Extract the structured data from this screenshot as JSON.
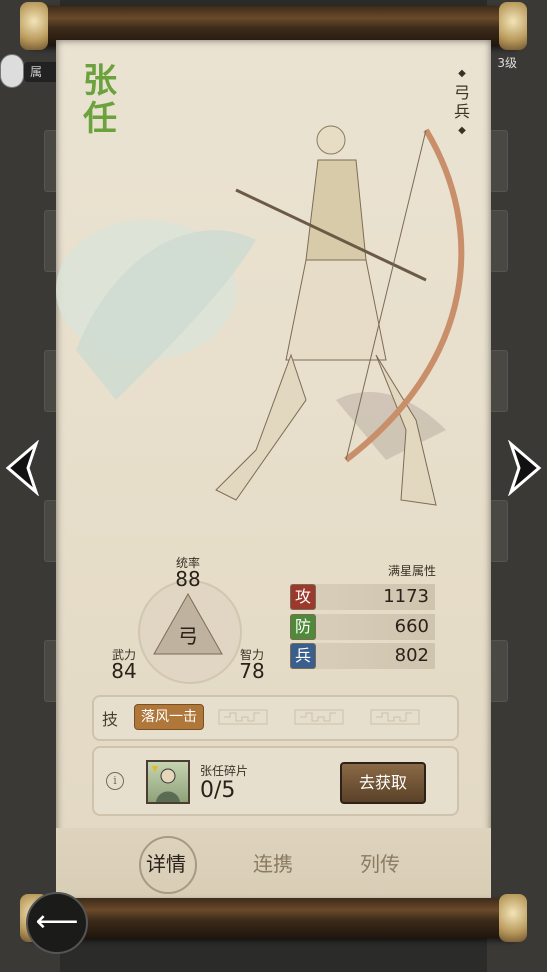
{
  "hero": {
    "name": "张任",
    "troop_type": "弓兵",
    "troop_type_char": "弓"
  },
  "stats": {
    "command_label": "统率",
    "command_value": "88",
    "force_label": "武力",
    "force_value": "84",
    "intel_label": "智力",
    "intel_value": "78"
  },
  "full_star": {
    "title": "满星属性",
    "attack_icon": "攻",
    "attack_value": "1173",
    "defense_icon": "防",
    "defense_value": "660",
    "troops_icon": "兵",
    "troops_value": "802",
    "attack_color": "#9b3a2c",
    "defense_color": "#4f8a3a",
    "troops_color": "#3a5f8c"
  },
  "skills": {
    "tag": "技",
    "skill1": "落风一击"
  },
  "shards": {
    "title": "张任碎片",
    "count": "0/5",
    "button_label": "去获取"
  },
  "tabs": {
    "detail": "详情",
    "link": "连携",
    "bio": "列传"
  },
  "background": {
    "left_badge": "属",
    "right_level": "3级"
  }
}
